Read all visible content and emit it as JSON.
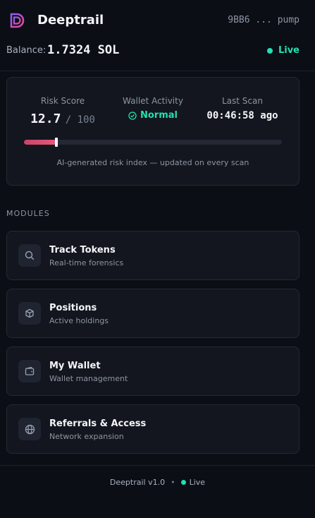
{
  "header": {
    "app_title": "Deeptrail",
    "wallet_address": "9BB6 ... pump"
  },
  "balance": {
    "label": "Balance:",
    "value": "1.7324 SOL",
    "status": "Live"
  },
  "risk": {
    "score_label": "Risk Score",
    "score_value": "12.7",
    "score_max": "/ 100",
    "score_fraction": 0.127,
    "activity_label": "Wallet Activity",
    "activity_value": "Normal",
    "scan_label": "Last Scan",
    "scan_value": "00:46:58 ago",
    "note": "AI-generated risk index — updated on every scan"
  },
  "modules": {
    "title": "MODULES",
    "items": [
      {
        "title": "Track Tokens",
        "subtitle": "Real-time forensics",
        "icon": "search-icon"
      },
      {
        "title": "Positions",
        "subtitle": "Active holdings",
        "icon": "cube-icon"
      },
      {
        "title": "My Wallet",
        "subtitle": "Wallet management",
        "icon": "wallet-icon"
      },
      {
        "title": "Referrals & Access",
        "subtitle": "Network expansion",
        "icon": "globe-icon"
      }
    ]
  },
  "footer": {
    "version": "Deeptrail v1.0",
    "separator": "•",
    "status": "Live"
  },
  "colors": {
    "accent": "#22e0b0",
    "risk_bar": "#e8577a",
    "background": "#0b0e15",
    "card": "#13161e"
  }
}
